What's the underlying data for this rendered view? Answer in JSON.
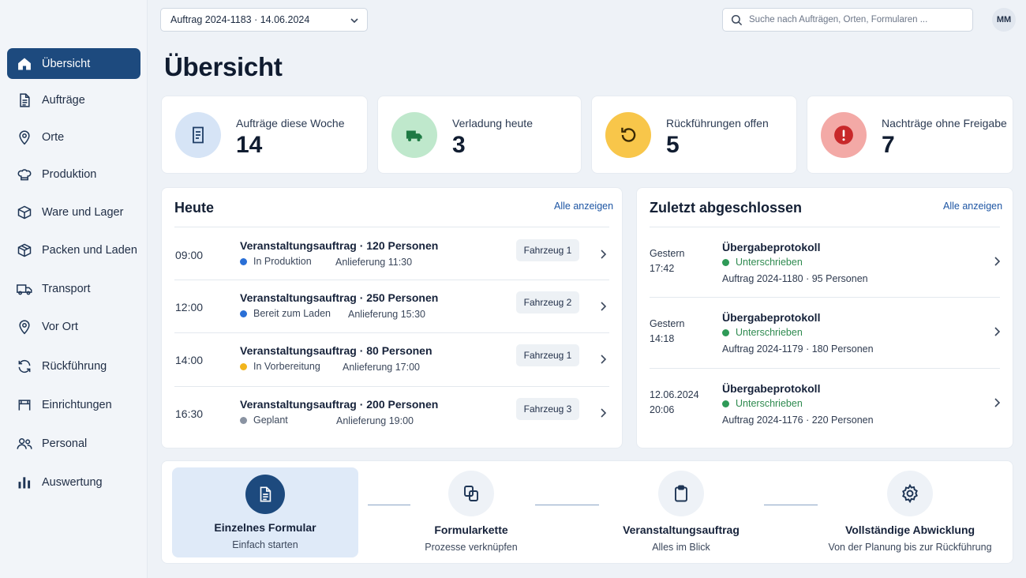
{
  "sidebar": {
    "items": [
      {
        "label": "Übersicht",
        "icon": "home-icon",
        "active": true
      },
      {
        "label": "Aufträge",
        "icon": "document-icon"
      },
      {
        "label": "Orte",
        "icon": "map-pin-icon"
      },
      {
        "label": "Produktion",
        "icon": "chef-hat-icon"
      },
      {
        "label": "Ware und Lager",
        "icon": "box-icon"
      },
      {
        "label": "Packen und Laden",
        "icon": "package-icon"
      },
      {
        "label": "Transport",
        "icon": "truck-icon"
      },
      {
        "label": "Vor Ort",
        "icon": "location-icon"
      },
      {
        "label": "Rückführung",
        "icon": "refresh-icon"
      },
      {
        "label": "Einrichtungen",
        "icon": "furniture-icon"
      },
      {
        "label": "Personal",
        "icon": "users-icon"
      },
      {
        "label": "Auswertung",
        "icon": "bar-chart-icon"
      }
    ]
  },
  "topbar": {
    "order_select": "Auftrag 2024-1183 · 14.06.2024",
    "search_placeholder": "Suche nach Aufträgen, Orten, Formularen ...",
    "avatar_initials": "MM"
  },
  "page": {
    "title": "Übersicht"
  },
  "stats": [
    {
      "label": "Aufträge diese Woche",
      "value": "14",
      "icon": "document-icon",
      "color": "#d6e4f6"
    },
    {
      "label": "Verladung heute",
      "value": "3",
      "icon": "truck-icon",
      "color": "#bfe8cc"
    },
    {
      "label": "Rückführungen offen",
      "value": "5",
      "icon": "undo-icon",
      "color": "#f8c64a"
    },
    {
      "label": "Nachträge ohne Freigabe",
      "value": "7",
      "icon": "alert-icon",
      "color": "#f3a9a6"
    }
  ],
  "today": {
    "title": "Heute",
    "link": "Alle anzeigen",
    "rows": [
      {
        "time": "09:00",
        "title": "Veranstaltungsauftrag · 120 Personen",
        "status": "In Produktion",
        "status_color": "#2a6fd6",
        "delivery": "Anlieferung 11:30",
        "vehicle": "Fahrzeug 1"
      },
      {
        "time": "12:00",
        "title": "Veranstaltungsauftrag · 250 Personen",
        "status": "Bereit zum Laden",
        "status_color": "#2a6fd6",
        "delivery": "Anlieferung 15:30",
        "vehicle": "Fahrzeug 2"
      },
      {
        "time": "14:00",
        "title": "Veranstaltungsauftrag · 80 Personen",
        "status": "In Vorbereitung",
        "status_color": "#f2b51c",
        "delivery": "Anlieferung 17:00",
        "vehicle": "Fahrzeug 1"
      },
      {
        "time": "16:30",
        "title": "Veranstaltungsauftrag · 200 Personen",
        "status": "Geplant",
        "status_color": "#8a93a2",
        "delivery": "Anlieferung 19:00",
        "vehicle": "Fahrzeug 3"
      }
    ]
  },
  "completed": {
    "title": "Zuletzt abgeschlossen",
    "link": "Alle anzeigen",
    "rows": [
      {
        "date1": "Gestern",
        "date2": "17:42",
        "title": "Übergabeprotokoll",
        "status": "Unterschrieben",
        "meta": "Auftrag 2024-1180 · 95 Personen"
      },
      {
        "date1": "Gestern",
        "date2": "14:18",
        "title": "Übergabeprotokoll",
        "status": "Unterschrieben",
        "meta": "Auftrag 2024-1179 · 180 Personen"
      },
      {
        "date1": "12.06.2024",
        "date2": "20:06",
        "title": "Übergabeprotokoll",
        "status": "Unterschrieben",
        "meta": "Auftrag 2024-1176 · 220 Personen"
      }
    ],
    "status_color": "#2e9a57"
  },
  "workflow": [
    {
      "title": "Einzelnes Formular",
      "subtitle": "Einfach starten",
      "icon": "document-icon",
      "active": true
    },
    {
      "title": "Formularkette",
      "subtitle": "Prozesse verknüpfen",
      "icon": "copy-icon"
    },
    {
      "title": "Veranstaltungsauftrag",
      "subtitle": "Alles im Blick",
      "icon": "clipboard-icon"
    },
    {
      "title": "Vollständige Abwicklung",
      "subtitle": "Von der Planung bis zur Rückführung",
      "icon": "settings-icon"
    }
  ]
}
